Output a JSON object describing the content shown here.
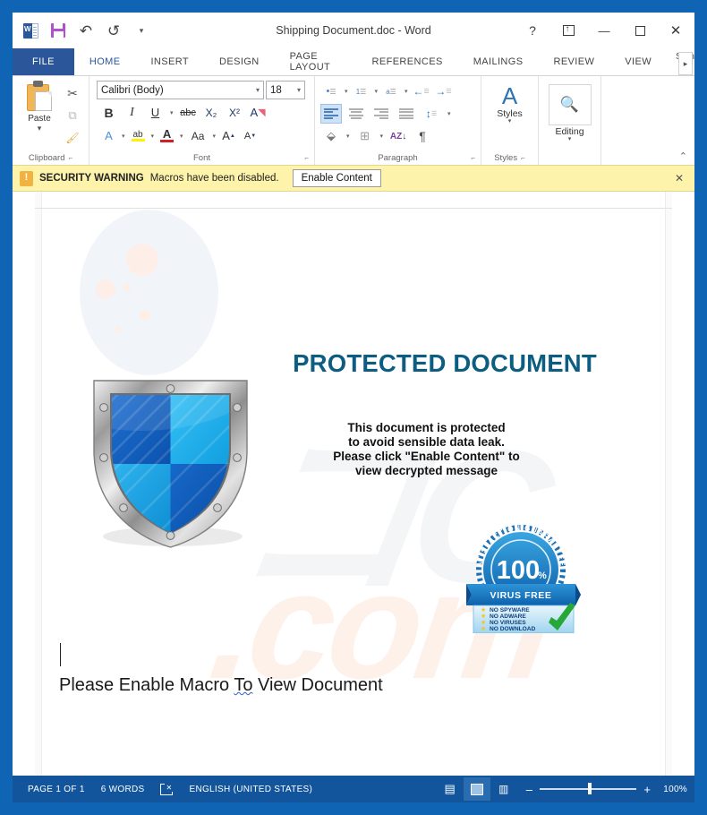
{
  "window": {
    "title": "Shipping Document.doc - Word",
    "frame_color": "#0f64b4",
    "accent_color": "#2b579a"
  },
  "quick_access": {
    "items": [
      {
        "name": "word-app-icon",
        "label": "W"
      },
      {
        "name": "save-icon",
        "label": ""
      },
      {
        "name": "undo-icon",
        "label": "↶"
      },
      {
        "name": "redo-icon",
        "label": "↺"
      },
      {
        "name": "customize-qat-icon",
        "label": "▾"
      }
    ]
  },
  "window_controls": {
    "help": "?",
    "ribbon_display_options": "▭",
    "minimize": "—",
    "restore": "▭",
    "close": "✕"
  },
  "tabs": {
    "file": "FILE",
    "items": [
      {
        "label": "HOME",
        "active": true
      },
      {
        "label": "INSERT",
        "active": false
      },
      {
        "label": "DESIGN",
        "active": false
      },
      {
        "label": "PAGE LAYOUT",
        "active": false
      },
      {
        "label": "REFERENCES",
        "active": false
      },
      {
        "label": "MAILINGS",
        "active": false
      },
      {
        "label": "REVIEW",
        "active": false
      },
      {
        "label": "VIEW",
        "active": false
      }
    ],
    "sign_in": "Sign",
    "more": "▸"
  },
  "ribbon": {
    "clipboard": {
      "label": "Clipboard",
      "paste_label": "Paste",
      "paste_caret": "▾",
      "cut": "✂",
      "copy": "⧉",
      "format_painter": "🖌",
      "dialog_launcher": "⌐"
    },
    "font": {
      "label": "Font",
      "font_name": "Calibri (Body)",
      "font_size": "18",
      "bold": "B",
      "italic": "I",
      "underline": "U",
      "strikethrough": "abc",
      "subscript": "X₂",
      "superscript": "X²",
      "clear_formatting": "A",
      "text_effects": "A",
      "highlight": "ab",
      "font_color": "A",
      "change_case": "Aa",
      "grow_font": "A",
      "shrink_font": "A",
      "dialog_launcher": "⌐"
    },
    "paragraph": {
      "label": "Paragraph",
      "bullets": "•",
      "numbering": "1",
      "multilevel": "a",
      "decrease_indent": "←",
      "increase_indent": "→",
      "align_left": "",
      "align_center": "",
      "align_right": "",
      "justify": "",
      "line_spacing": "↕",
      "shading": "",
      "borders": "",
      "sort": "AZ",
      "show_marks": "¶",
      "dialog_launcher": "⌐"
    },
    "styles": {
      "label": "Styles",
      "button_label": "Styles",
      "caret": "▾",
      "dialog_launcher": "⌐"
    },
    "editing": {
      "label": "Editing",
      "button_label": "Editing",
      "caret": "▾",
      "icon": "🔍"
    },
    "collapse": "⌃"
  },
  "security_bar": {
    "icon": "warning-icon",
    "strong": "SECURITY WARNING",
    "message": "Macros have been disabled.",
    "button": "Enable Content",
    "close": "✕",
    "background": "#fdf3ab"
  },
  "document": {
    "headline": "PROTECTED DOCUMENT",
    "headline_color": "#0d5d82",
    "sub_lines": [
      "This document is protected",
      "to avoid sensible data leak.",
      "Please click \"Enable Content\" to",
      "view decrypted message"
    ],
    "badge": {
      "arc_text": "SATISFACTION GUARANTEED",
      "percent": "100",
      "percent_symbol": "%",
      "ribbon_text": "VIRUS FREE",
      "claims": [
        "NO SPYWARE",
        "NO ADWARE",
        "NO VIRUSES",
        "NO DOWNLOAD"
      ],
      "check": "✔"
    },
    "body_text_before": "Please Enable Macro ",
    "body_text_squiggle": "To",
    "body_text_after": " View Document"
  },
  "status_bar": {
    "page": "PAGE 1 OF 1",
    "words": "6 WORDS",
    "proofing_icon": "proofing-errors-icon",
    "language": "ENGLISH (UNITED STATES)",
    "views": [
      {
        "name": "read-mode-view",
        "glyph": "📖",
        "active": false
      },
      {
        "name": "print-layout-view",
        "glyph": "▤",
        "active": true
      },
      {
        "name": "web-layout-view",
        "glyph": "🌐",
        "active": false
      }
    ],
    "zoom_out": "–",
    "zoom_in": "+",
    "zoom_level": "100%",
    "background": "#12559c"
  }
}
